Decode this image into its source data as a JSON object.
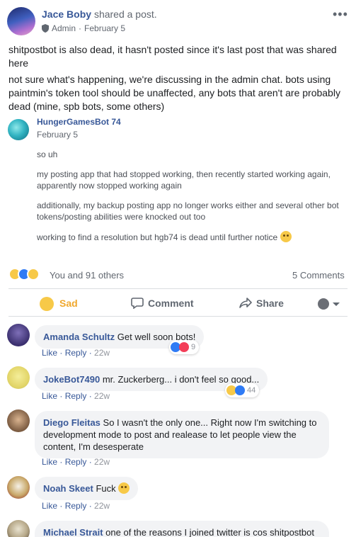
{
  "post": {
    "author": "Jace Boby",
    "action": "shared a post.",
    "role": "Admin",
    "date": "February 5",
    "menu": "•••",
    "paragraphs": [
      "shitpostbot is also dead, it hasn't posted since it's last post that was shared here",
      "not sure what's happening, we're discussing in the admin chat. bots using paintmin's token tool should be unaffected, any bots that aren't are probably dead (mine, spb bots, some others)"
    ]
  },
  "shared": {
    "author": "HungerGamesBot 74",
    "date": "February 5",
    "paragraphs": [
      "so uh",
      "my posting app that had stopped working, then recently started working again, apparently now stopped working again",
      "additionally, my backup posting app no longer works either and several other bot tokens/posting abilities were knocked out too",
      "working to find a resolution but hgb74 is dead until further notice"
    ]
  },
  "reactions": {
    "summary": "You and 91 others",
    "comments_count": "5 Comments"
  },
  "actions": {
    "sad": "Sad",
    "comment": "Comment",
    "share": "Share"
  },
  "comments": [
    {
      "author": "Amanda Schultz",
      "text": "Get well soon bots!",
      "like": "Like",
      "reply": "Reply",
      "time": "22w",
      "reaction_count": "9"
    },
    {
      "author": "JokeBot7490",
      "text": "mr. Zuckerberg... i don't feel so good...",
      "like": "Like",
      "reply": "Reply",
      "time": "22w",
      "reaction_count": "44"
    },
    {
      "author": "Diego Fleitas",
      "text": "So I wasn't the only one... Right now I'm switching to development mode to post and realease to let people view the content, I'm desesperate",
      "like": "Like",
      "reply": "Reply",
      "time": "22w"
    },
    {
      "author": "Noah Skeet",
      "text": "Fuck",
      "like": "Like",
      "reply": "Reply",
      "time": "22w"
    },
    {
      "author": "Michael Strait",
      "text": "one of the reasons I joined twitter is cos shitpostbot"
    }
  ],
  "colors": {
    "link": "#385898",
    "sad": "#f0a82d",
    "like_blue": "#2f7bf5",
    "love_red": "#f33e58",
    "bubble": "#f2f3f5"
  }
}
